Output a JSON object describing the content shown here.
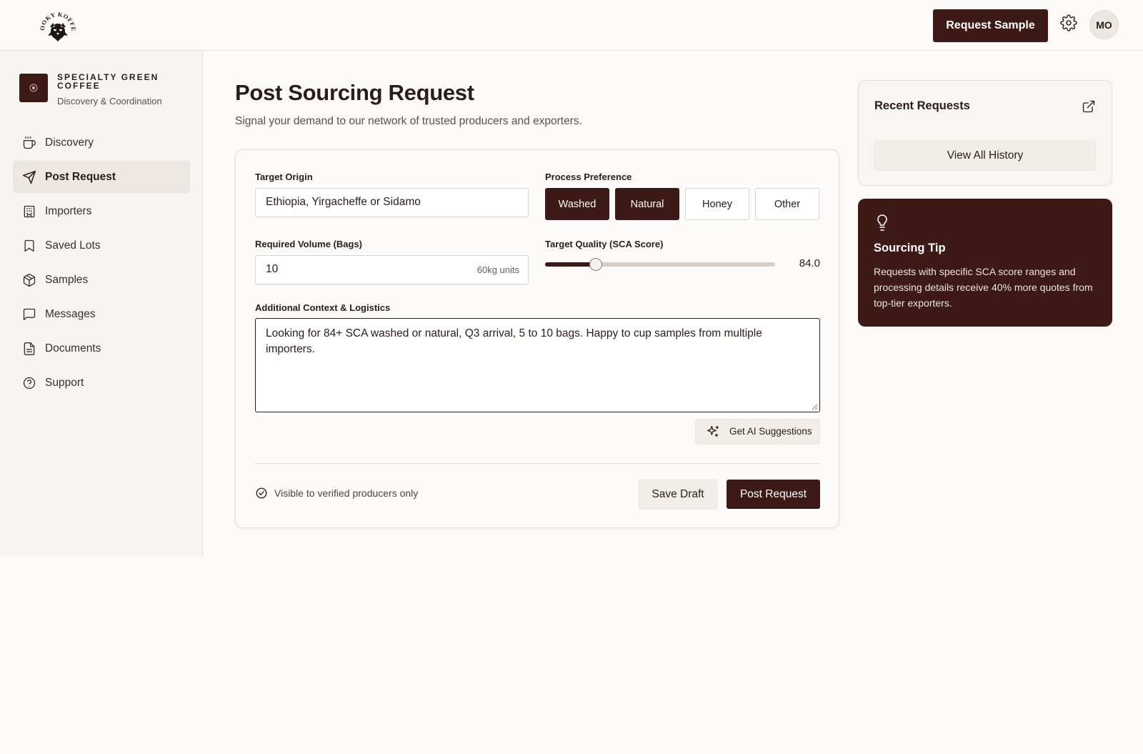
{
  "header": {
    "logo_text": "KOOKY KOFFEE",
    "request_sample_label": "Request Sample",
    "avatar_initials": "MO"
  },
  "sidebar": {
    "brand_title": "SPECIALTY GREEN COFFEE",
    "brand_subtitle": "Discovery & Coordination",
    "items": [
      {
        "label": "Discovery",
        "icon": "coffee-cup-icon",
        "active": false
      },
      {
        "label": "Post Request",
        "icon": "send-icon",
        "active": true
      },
      {
        "label": "Importers",
        "icon": "building-icon",
        "active": false
      },
      {
        "label": "Saved Lots",
        "icon": "bookmark-icon",
        "active": false
      },
      {
        "label": "Samples",
        "icon": "package-icon",
        "active": false
      },
      {
        "label": "Messages",
        "icon": "message-icon",
        "active": false
      },
      {
        "label": "Documents",
        "icon": "document-icon",
        "active": false
      },
      {
        "label": "Support",
        "icon": "help-circle-icon",
        "active": false
      }
    ]
  },
  "main": {
    "title": "Post Sourcing Request",
    "subtitle": "Signal your demand to our network of trusted producers and exporters."
  },
  "form": {
    "origin_label": "Target Origin",
    "origin_value": "Ethiopia, Yirgacheffe or Sidamo",
    "process_label": "Process Preference",
    "process_options": [
      {
        "label": "Washed",
        "selected": true
      },
      {
        "label": "Natural",
        "selected": true
      },
      {
        "label": "Honey",
        "selected": false
      },
      {
        "label": "Other",
        "selected": false
      }
    ],
    "volume_label": "Required Volume (Bags)",
    "volume_value": "10",
    "volume_suffix": "60kg units",
    "quality_label": "Target Quality (SCA Score)",
    "quality_value": "84.0",
    "quality_fraction": 0.22,
    "context_label": "Additional Context & Logistics",
    "context_value": "Looking for 84+ SCA washed or natural, Q3 arrival, 5 to 10 bags. Happy to cup samples from multiple importers.",
    "ai_label": "Get AI Suggestions",
    "visibility_text": "Visible to verified producers only",
    "save_label": "Save Draft",
    "post_label": "Post Request"
  },
  "recent": {
    "title": "Recent Requests",
    "view_all_label": "View All History"
  },
  "tip": {
    "title": "Sourcing Tip",
    "text": "Requests with specific SCA score ranges and processing details receive 40% more quotes from top-tier exporters."
  },
  "colors": {
    "brand": "#3d1a15",
    "background": "#fbfaf8",
    "active_nav": "#ece7e2"
  }
}
